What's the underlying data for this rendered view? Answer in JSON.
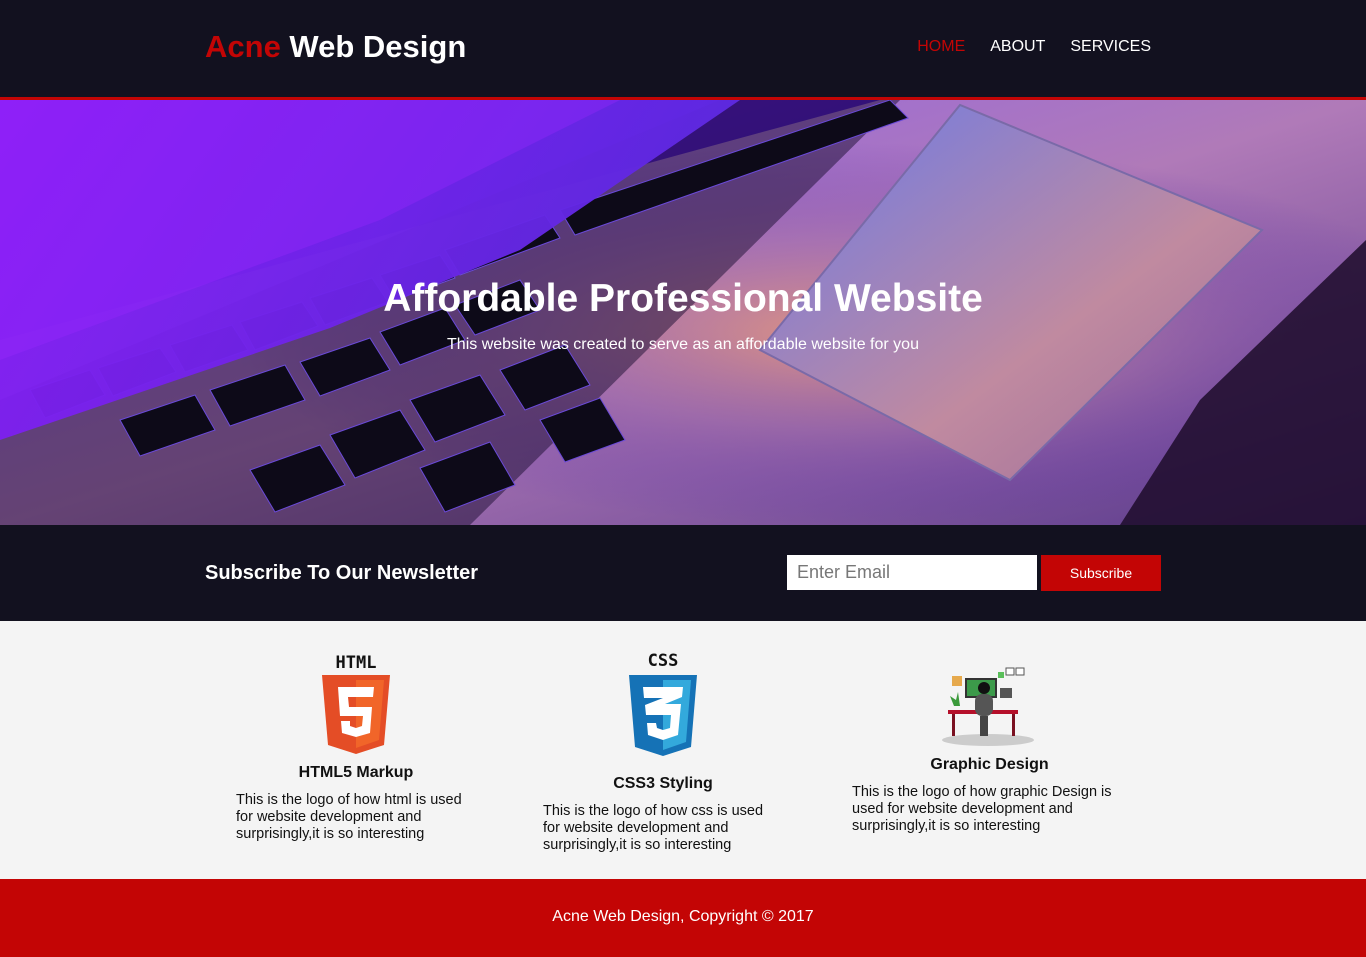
{
  "header": {
    "brand_highlight": "Acne",
    "brand_rest": " Web Design",
    "nav": [
      {
        "label": "HOME",
        "active": true
      },
      {
        "label": "ABOUT",
        "active": false
      },
      {
        "label": "SERVICES",
        "active": false
      }
    ]
  },
  "showcase": {
    "title": "Affordable Professional Website",
    "subtitle": "This website was created to serve as an affordable website for you",
    "background_image": "laptop-keyboard-photo"
  },
  "newsletter": {
    "title": "Subscribe To Our Newsletter",
    "email_placeholder": "Enter Email",
    "email_value": "",
    "button_label": "Subscribe"
  },
  "boxes": [
    {
      "icon": "html5-logo-icon",
      "logo_text": "HTML",
      "title": "HTML5 Markup",
      "text": "This is the logo of how html is used for website development and surprisingly,it is so interesting"
    },
    {
      "icon": "css3-logo-icon",
      "logo_text": "CSS",
      "title": "CSS3 Styling",
      "text": "This is the logo of how css is used for website development and surprisingly,it is so interesting"
    },
    {
      "icon": "designer-at-desk-icon",
      "title": "Graphic Design",
      "text": "This is the logo of how graphic Design is used for website development and surprisingly,it is so interesting"
    }
  ],
  "footer": {
    "text": "Acne Web Design, Copyright © 2017"
  },
  "colors": {
    "accent": "#c30505",
    "dark": "#12111f",
    "light": "#f4f4f4"
  }
}
